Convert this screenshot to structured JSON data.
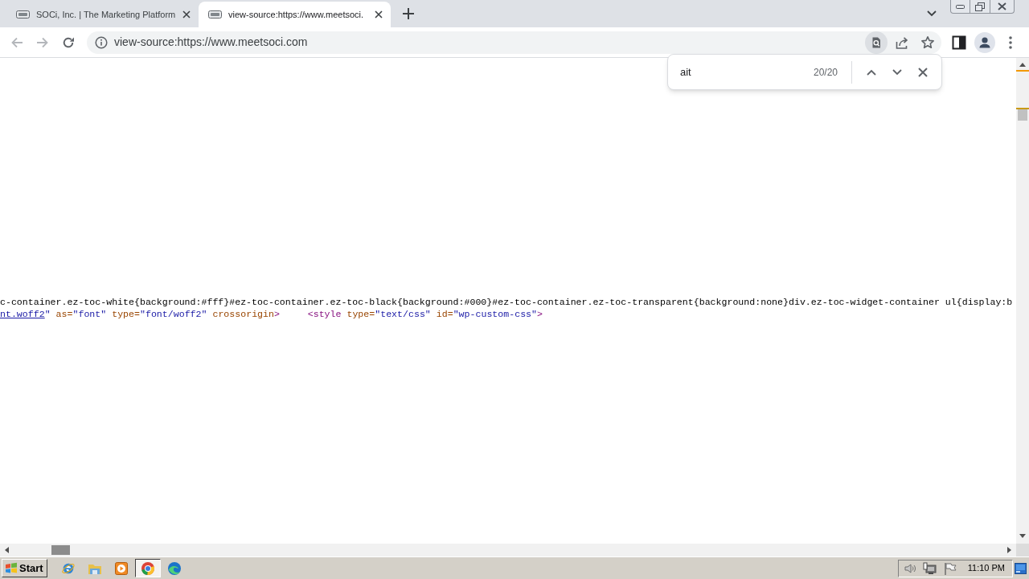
{
  "tabs": [
    {
      "title": "SOCi, Inc. | The Marketing Platform",
      "selected": false
    },
    {
      "title": "view-source:https://www.meetsoci.",
      "selected": true
    }
  ],
  "nav_buttons": [
    {
      "kind": "back",
      "disabled": true
    },
    {
      "kind": "forward",
      "disabled": true
    },
    {
      "kind": "reload",
      "disabled": false
    }
  ],
  "address_bar": {
    "url": "view-source:https://www.meetsoci.com"
  },
  "find_bar": {
    "query": "ait",
    "match_count": "20/20"
  },
  "source_lines": [
    {
      "tokens": [
        {
          "kind": "text",
          "text": "c-container.ez-toc-white{background:#fff}#ez-toc-container.ez-toc-black{background:#000}#ez-toc-container.ez-toc-transparent{background:none}div.ez-toc-widget-container ul{display:b"
        }
      ]
    },
    {
      "tokens": [
        {
          "kind": "link",
          "text": "nt.woff2"
        },
        {
          "kind": "value",
          "text": "\""
        },
        {
          "kind": "attr",
          "text": " as="
        },
        {
          "kind": "value",
          "text": "\"font\""
        },
        {
          "kind": "attr",
          "text": " type="
        },
        {
          "kind": "value",
          "text": "\"font/woff2\""
        },
        {
          "kind": "attr",
          "text": " crossorigin"
        },
        {
          "kind": "tag",
          "text": ">"
        },
        {
          "kind": "tag",
          "text": "     <style"
        },
        {
          "kind": "attr",
          "text": " type="
        },
        {
          "kind": "value",
          "text": "\"text/css\""
        },
        {
          "kind": "attr",
          "text": " id="
        },
        {
          "kind": "value",
          "text": "\"wp-custom-css\""
        },
        {
          "kind": "tag",
          "text": ">"
        }
      ]
    }
  ],
  "taskbar": {
    "start_label": "Start",
    "apps": [
      {
        "kind": "letter",
        "selected": false
      },
      {
        "kind": "folder",
        "selected": false
      },
      {
        "kind": "player",
        "selected": false
      },
      {
        "kind": "ring",
        "selected": true
      },
      {
        "kind": "wave",
        "selected": false
      }
    ],
    "clock": "11:10 PM"
  }
}
